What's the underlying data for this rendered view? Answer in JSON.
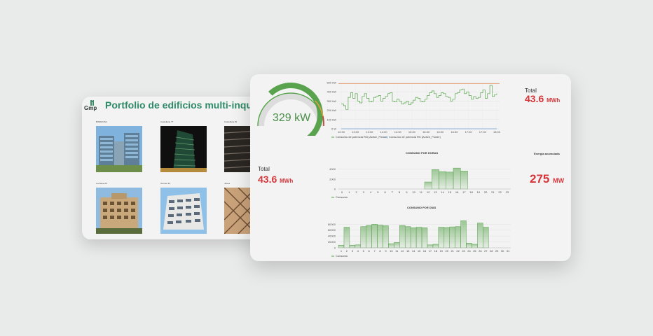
{
  "portfolio": {
    "logo_text": "Gmp",
    "title": "Portfolio de edificios multi-inquilino",
    "buildings": [
      {
        "name": "BINDHOSA"
      },
      {
        "name": "Castellana 77"
      },
      {
        "name": "Castellana 81"
      },
      {
        "name": "Luchana 23"
      },
      {
        "name": "Orense 34"
      },
      {
        "name": "Josea"
      }
    ]
  },
  "dashboard": {
    "gauge": {
      "value": "329 kW",
      "fill_fraction": 0.78
    },
    "total_top": {
      "label": "Total",
      "value": "43.6",
      "unit": "MWh"
    },
    "total_left": {
      "label": "Total",
      "value": "43.6",
      "unit": "MWh"
    },
    "energy": {
      "label": "Energía acumulada",
      "value": "275",
      "unit": "MW"
    },
    "colors": {
      "green": "#5aa34e",
      "red": "#d6363a",
      "orange": "#e8a03c"
    }
  },
  "chart_data": [
    {
      "type": "line",
      "title": "",
      "x_ticks": [
        "12:30",
        "13:00",
        "13:30",
        "14:00",
        "14:30",
        "15:00",
        "15:30",
        "16:00",
        "16:30",
        "17:00",
        "17:30",
        "18:00"
      ],
      "y_ticks": [
        "500 kW",
        "400 kW",
        "300 kW",
        "200 kW",
        "100 kW",
        "0 W"
      ],
      "ylim": [
        0,
        500
      ],
      "threshold": 490,
      "series": [
        {
          "name": "Consumo de potencia RN (Active_Power)",
          "values": [
            270,
            250,
            210,
            340,
            390,
            330,
            380,
            300,
            280,
            350,
            380,
            330,
            290,
            300,
            340,
            350,
            360,
            300,
            330,
            350,
            380,
            390,
            300,
            290,
            320,
            300,
            270,
            280,
            300,
            260,
            280,
            310,
            340,
            330,
            300,
            290,
            320,
            360,
            390,
            410,
            380,
            340,
            360,
            390,
            380,
            350,
            340,
            300,
            320,
            380,
            390,
            420,
            430,
            380,
            400,
            360,
            320,
            350,
            330,
            340,
            390,
            420,
            330,
            380,
            470,
            350,
            370,
            380
          ]
        },
        {
          "name": "Consumo de potencia RS (Active_Power)",
          "values": [
            0,
            0,
            0,
            0,
            0,
            0,
            0,
            0,
            0,
            0,
            0,
            0,
            0,
            0,
            0,
            0,
            0,
            0,
            0,
            0,
            0,
            0,
            0,
            0,
            0,
            0,
            0,
            0,
            0,
            0,
            0,
            0,
            0,
            0,
            0,
            0,
            0,
            0,
            0,
            0,
            0,
            0,
            0,
            0,
            0,
            0,
            0,
            0,
            0,
            0,
            0,
            0,
            0,
            0,
            0,
            0,
            0,
            0,
            0,
            0,
            0,
            0,
            0,
            0,
            0,
            0,
            0,
            0
          ]
        }
      ]
    },
    {
      "type": "bar",
      "title": "CONSUMO POR HORAS",
      "categories": [
        "0",
        "1",
        "2",
        "3",
        "4",
        "5",
        "6",
        "7",
        "8",
        "9",
        "10",
        "11",
        "12",
        "13",
        "14",
        "15",
        "16",
        "17",
        "18",
        "19",
        "20",
        "21",
        "22",
        "23"
      ],
      "values": [
        0,
        0,
        0,
        0,
        0,
        0,
        0,
        0,
        0,
        0,
        0,
        0,
        1400,
        3900,
        3500,
        3400,
        4200,
        3600,
        0,
        0,
        0,
        0,
        0,
        0
      ],
      "y_ticks": [
        "4000",
        "2000",
        "0"
      ],
      "ylim": [
        0,
        4500
      ],
      "legend": "Consumo"
    },
    {
      "type": "bar",
      "title": "CONSUMO POR DÍAS",
      "categories": [
        "1",
        "2",
        "3",
        "4",
        "5",
        "6",
        "7",
        "8",
        "9",
        "10",
        "11",
        "12",
        "13",
        "14",
        "15",
        "16",
        "17",
        "18",
        "19",
        "20",
        "21",
        "22",
        "23",
        "24",
        "25",
        "26",
        "27",
        "28",
        "29",
        "30",
        "31"
      ],
      "values": [
        9000,
        70000,
        9000,
        10000,
        72000,
        76000,
        80000,
        77000,
        75000,
        14000,
        18000,
        76000,
        72000,
        68000,
        70000,
        68000,
        10000,
        12000,
        70000,
        69000,
        71000,
        72000,
        92000,
        16000,
        12000,
        84000,
        70000,
        0,
        0,
        0,
        0
      ],
      "y_ticks": [
        "80000",
        "60000",
        "40000",
        "20000",
        "0"
      ],
      "ylim": [
        0,
        95000
      ],
      "legend": "Consumo"
    }
  ]
}
